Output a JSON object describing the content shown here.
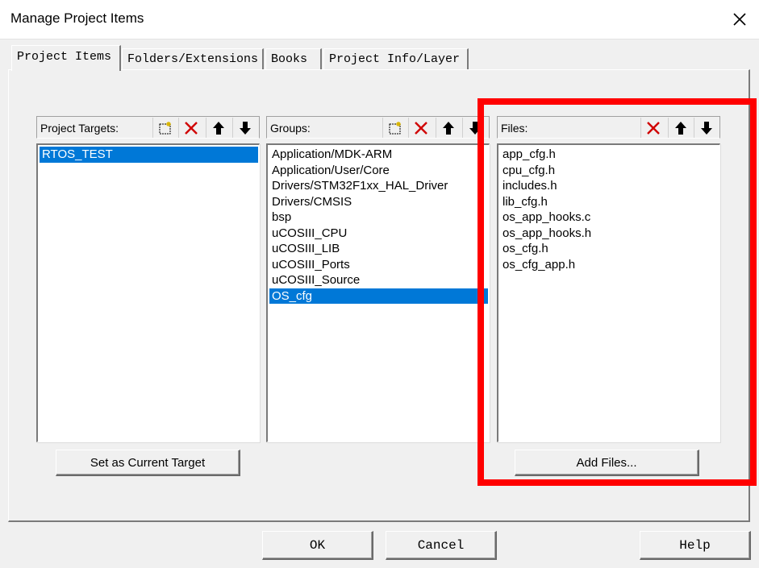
{
  "window": {
    "title": "Manage Project Items"
  },
  "tabs": [
    {
      "label": "Project Items"
    },
    {
      "label": "Folders/Extensions"
    },
    {
      "label": "Books"
    },
    {
      "label": "Project Info/Layer"
    }
  ],
  "targets": {
    "header": "Project Targets:",
    "items": [
      "RTOS_TEST"
    ],
    "selected": "RTOS_TEST",
    "set_current_label": "Set as Current Target"
  },
  "groups": {
    "header": "Groups:",
    "items": [
      "Application/MDK-ARM",
      "Application/User/Core",
      "Drivers/STM32F1xx_HAL_Driver",
      "Drivers/CMSIS",
      "bsp",
      "uCOSIII_CPU",
      "uCOSIII_LIB",
      "uCOSIII_Ports",
      "uCOSIII_Source",
      "OS_cfg"
    ],
    "selected": "OS_cfg"
  },
  "files": {
    "header": "Files:",
    "items": [
      "app_cfg.h",
      "cpu_cfg.h",
      "includes.h",
      "lib_cfg.h",
      "os_app_hooks.c",
      "os_app_hooks.h",
      "os_cfg.h",
      "os_cfg_app.h"
    ],
    "add_label": "Add Files..."
  },
  "buttons": {
    "ok": "OK",
    "cancel": "Cancel",
    "help": "Help"
  },
  "colors": {
    "selection": "#0078d7",
    "annotation": "#ff0000"
  }
}
